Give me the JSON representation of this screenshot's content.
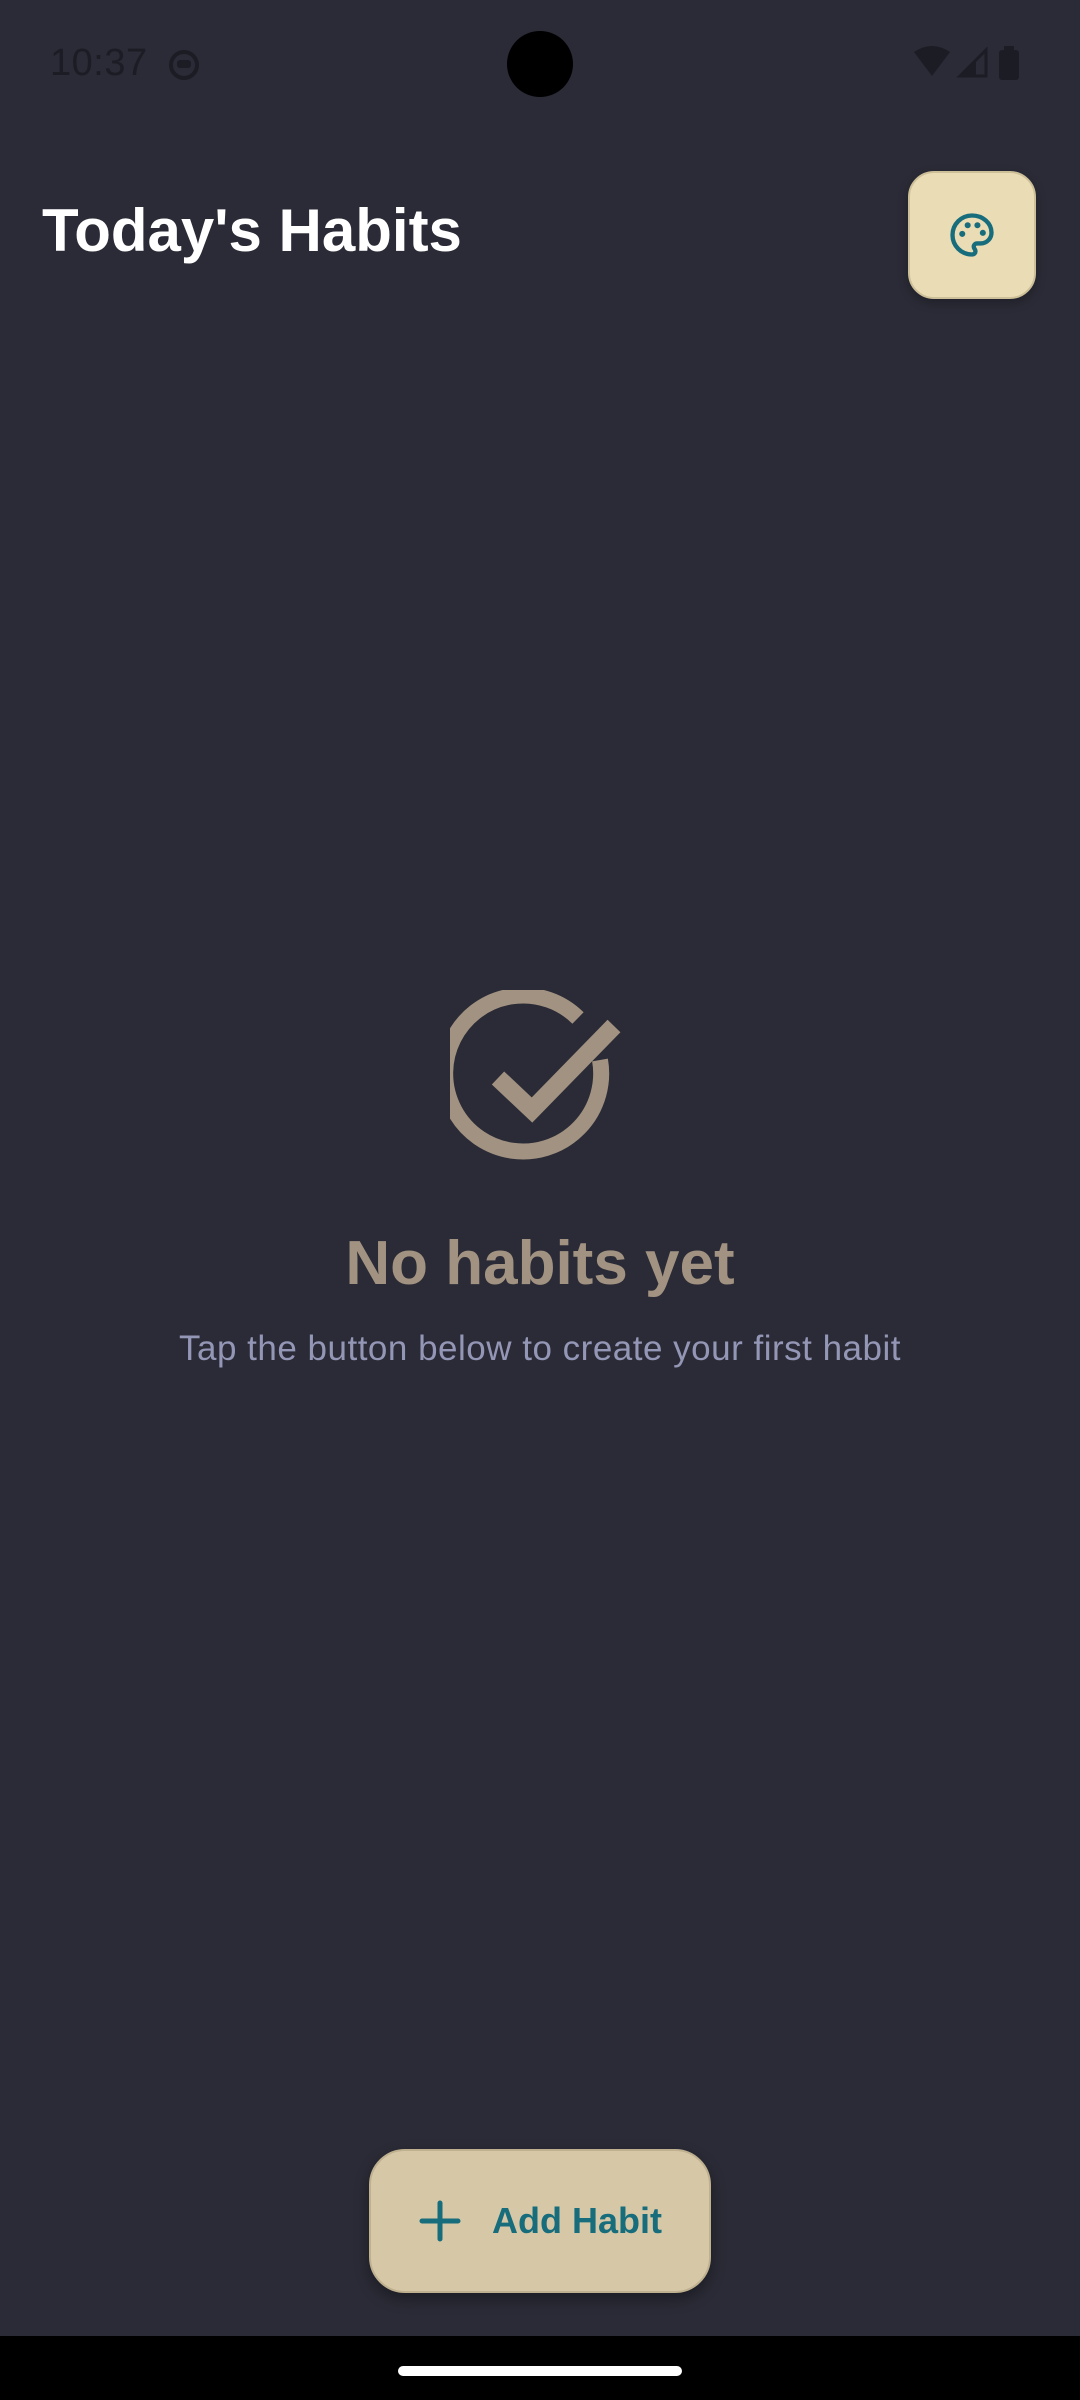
{
  "status_bar": {
    "time": "10:37",
    "icons": [
      "app-notification-icon",
      "wifi-icon",
      "cellular-signal-icon",
      "battery-icon"
    ]
  },
  "header": {
    "title": "Today's Habits",
    "palette_button_icon": "palette-icon"
  },
  "empty_state": {
    "icon": "check-circle-icon",
    "title": "No habits yet",
    "subtitle": "Tap the button below to create your first habit"
  },
  "fab": {
    "icon": "plus-icon",
    "label": "Add Habit"
  },
  "colors": {
    "background": "#2a2b36",
    "accent_button": "#eadcb5",
    "fab_background": "#d6c8a6",
    "accent_teal": "#176d7c",
    "muted_title": "#a29281",
    "muted_subtitle": "#9496b6"
  }
}
